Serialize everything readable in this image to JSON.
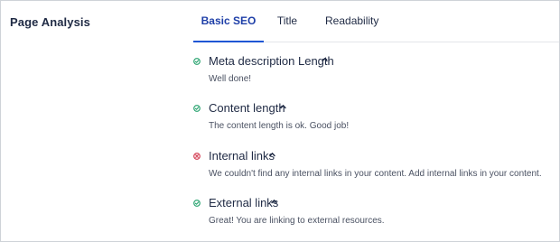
{
  "sidebar": {
    "title": "Page Analysis"
  },
  "tabs": [
    {
      "label": "Basic SEO",
      "active": true
    },
    {
      "label": "Title",
      "active": false
    },
    {
      "label": "Readability",
      "active": false
    }
  ],
  "checks": [
    {
      "label": "Meta description Length",
      "status": "pass",
      "description": "Well done!"
    },
    {
      "label": "Content length",
      "status": "pass",
      "description": "The content length is ok. Good job!"
    },
    {
      "label": "Internal links",
      "status": "fail",
      "description": "We couldn't find any internal links in your content. Add internal links in your content."
    },
    {
      "label": "External links",
      "status": "pass",
      "description": "Great! You are linking to external resources."
    }
  ],
  "colors": {
    "pass": "#22a06b",
    "fail": "#d1344a",
    "accent": "#1f56d4"
  }
}
